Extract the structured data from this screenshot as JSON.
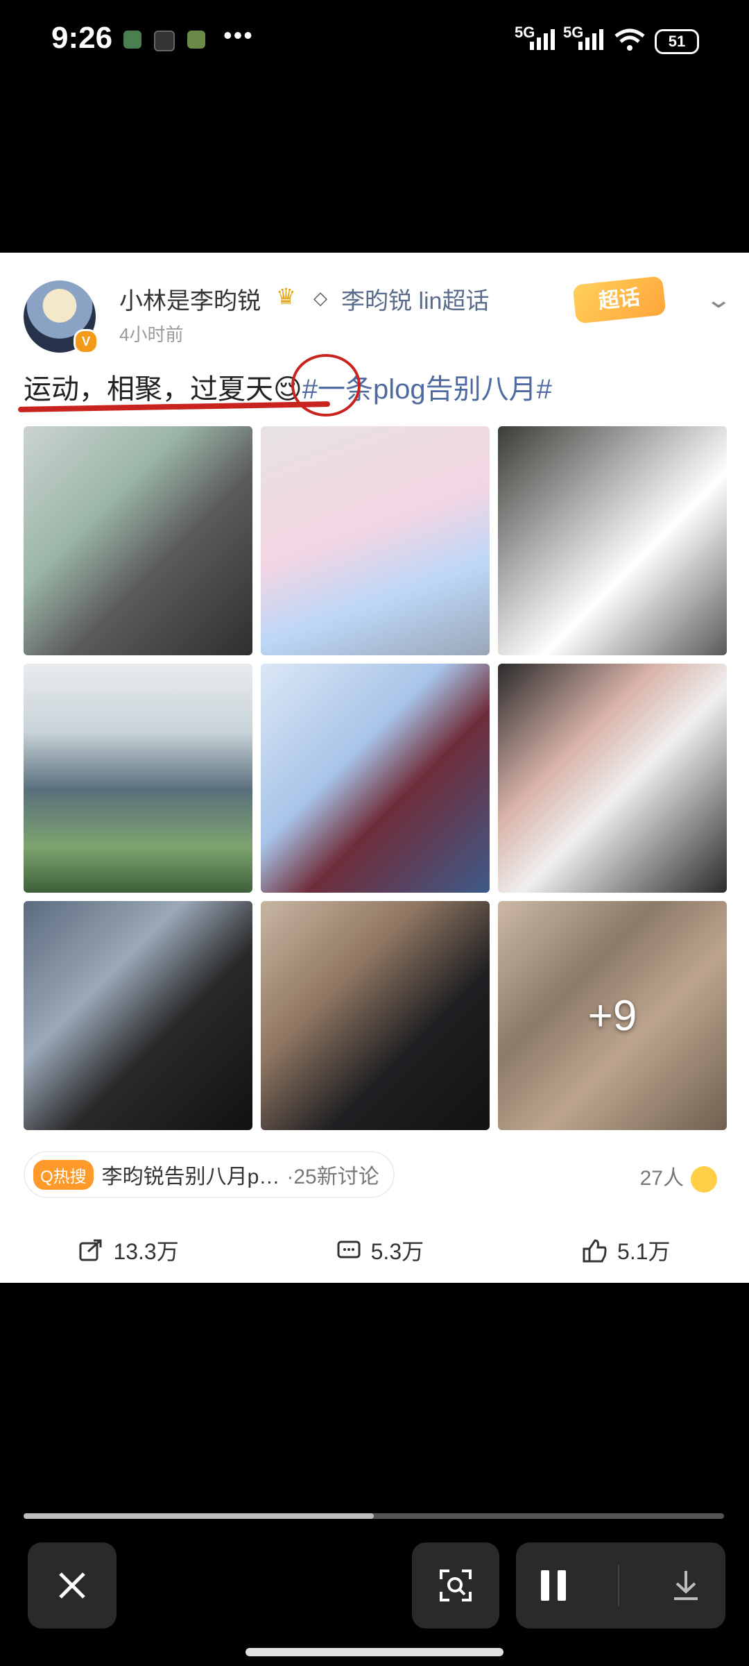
{
  "status_bar": {
    "time": "9:26",
    "dots": "•••",
    "network1": "5G",
    "network2": "5G",
    "battery": "51"
  },
  "post": {
    "username": "小林是李昀锐",
    "topic": "李昀锐 lin超话",
    "timeago": "4小时前",
    "super_badge": "超话",
    "text_main": "运动，相聚，过夏天",
    "text_emoji": "😌",
    "text_hashtag": "#一条plog告别八月#",
    "more_count": "+9",
    "hot_tag": "Q热搜",
    "hot_topic": "李昀锐告别八月p…",
    "hot_count": "·25新讨论",
    "like_people": "27人",
    "actions": {
      "repost": "13.3万",
      "comment": "5.3万",
      "like": "5.1万"
    }
  },
  "media": {
    "progress_fraction": 0.5
  },
  "colors": {
    "accent_orange": "#ff9a2a",
    "annotation_red": "#c8231f",
    "hashtag_blue": "#4f6aa1"
  }
}
